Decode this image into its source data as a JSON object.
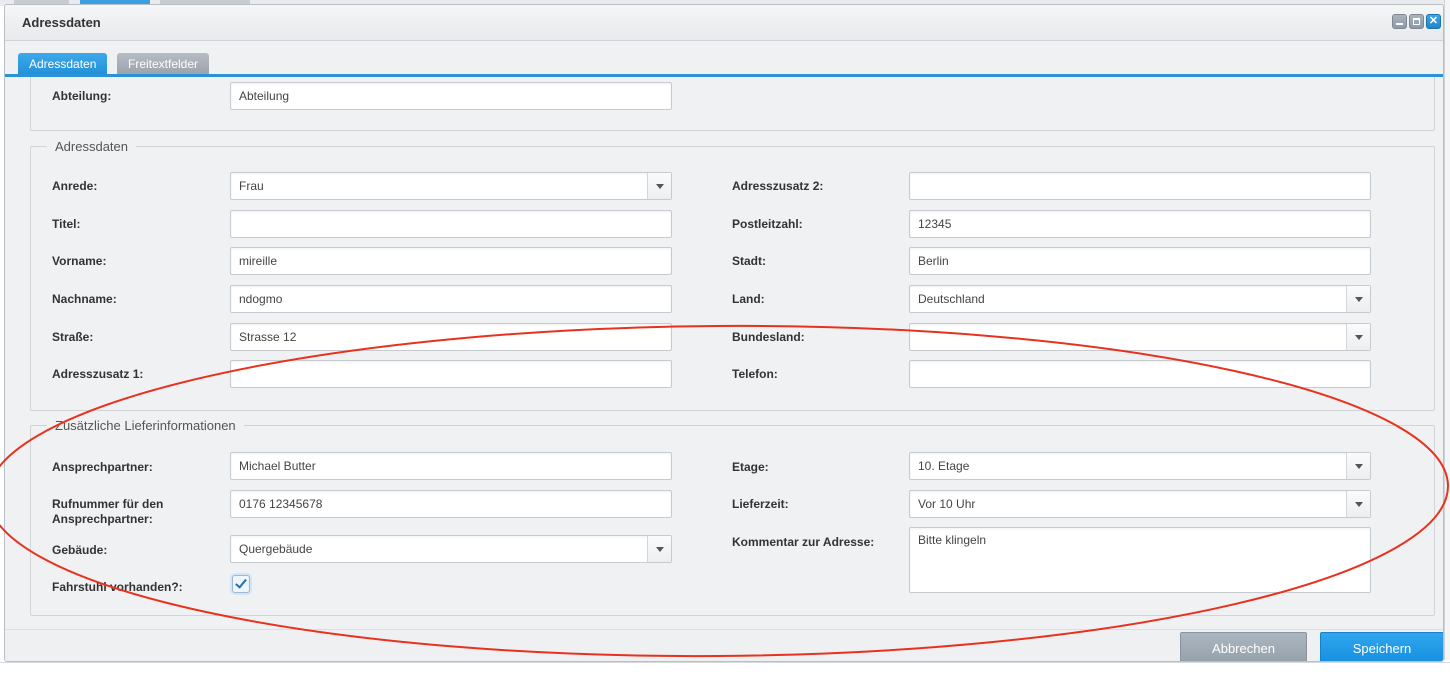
{
  "window": {
    "title": "Adressdaten",
    "controls": [
      "minimize",
      "maximize",
      "close"
    ]
  },
  "tabs": [
    {
      "label": "Adressdaten",
      "active": true
    },
    {
      "label": "Freitextfelder",
      "active": false
    }
  ],
  "top_section": {
    "abteilung": {
      "label": "Abteilung:",
      "value": "Abteilung"
    }
  },
  "adressdaten": {
    "legend": "Adressdaten",
    "anrede": {
      "label": "Anrede:",
      "value": "Frau"
    },
    "titel": {
      "label": "Titel:",
      "value": ""
    },
    "vorname": {
      "label": "Vorname:",
      "value": "mireille"
    },
    "nachname": {
      "label": "Nachname:",
      "value": "ndogmo"
    },
    "strasse": {
      "label": "Straße:",
      "value": "Strasse 12"
    },
    "adresszusatz1": {
      "label": "Adresszusatz 1:",
      "value": ""
    },
    "adresszusatz2": {
      "label": "Adresszusatz 2:",
      "value": ""
    },
    "postleitzahl": {
      "label": "Postleitzahl:",
      "value": "12345"
    },
    "stadt": {
      "label": "Stadt:",
      "value": "Berlin"
    },
    "land": {
      "label": "Land:",
      "value": "Deutschland"
    },
    "bundesland": {
      "label": "Bundesland:",
      "value": ""
    },
    "telefon": {
      "label": "Telefon:",
      "value": ""
    }
  },
  "lieferinfo": {
    "legend": "Zusätzliche Lieferinformationen",
    "ansprechpartner": {
      "label": "Ansprechpartner:",
      "value": "Michael Butter"
    },
    "rufnummer": {
      "label_line1": "Rufnummer für den",
      "label_line2": "Ansprechpartner:",
      "value": "0176 12345678"
    },
    "gebaeude": {
      "label": "Gebäude:",
      "value": "Quergebäude"
    },
    "fahrstuhl": {
      "label": "Fahrstuhl vorhanden?:",
      "checked": true
    },
    "etage": {
      "label": "Etage:",
      "value": "10. Etage"
    },
    "lieferzeit": {
      "label": "Lieferzeit:",
      "value": "Vor 10 Uhr"
    },
    "kommentar": {
      "label": "Kommentar zur Adresse:",
      "value": "Bitte klingeln"
    }
  },
  "footer": {
    "cancel_label": "Abbrechen",
    "save_label": "Speichern"
  },
  "colors": {
    "accent": "#2290d8",
    "annotation": "#e8321e"
  }
}
